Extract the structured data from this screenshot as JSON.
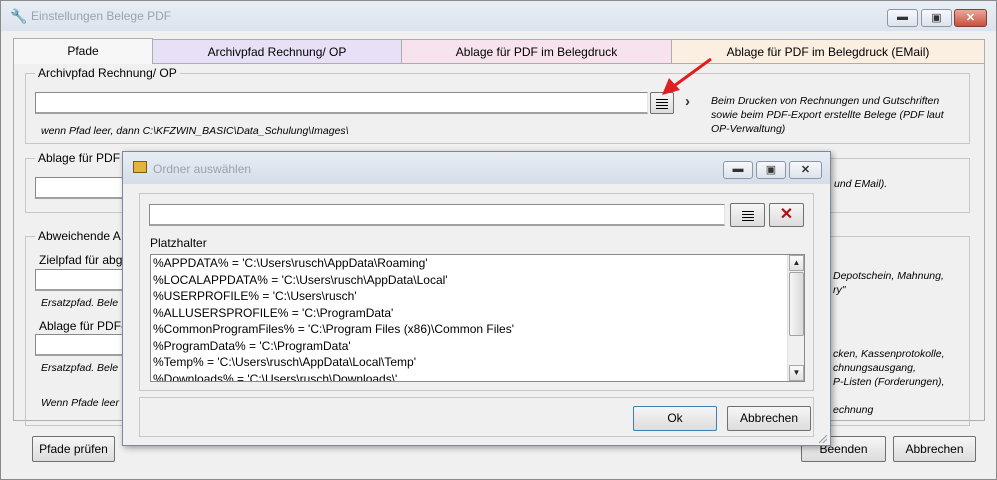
{
  "window": {
    "title": "Einstellungen Belege PDF",
    "controls": {
      "minimize": "▬",
      "maximize": "▣",
      "close": "✕"
    }
  },
  "tabs": [
    {
      "label": "Pfade",
      "color": "#f0f0f0"
    },
    {
      "label": "Archivpfad Rechnung/ OP",
      "color": "#e8e0f7"
    },
    {
      "label": "Ablage für PDF im Belegdruck",
      "color": "#f6e3ee"
    },
    {
      "label": "Ablage für PDF im Belegdruck (EMail)",
      "color": "#fbefe2"
    }
  ],
  "archive_group": {
    "legend": "Archivpfad Rechnung/ OP",
    "path_value": "",
    "hint": "wenn Pfad leer, dann C:\\KFZWIN_BASIC\\Data_Schulung\\Images\\",
    "info": "Beim Drucken von Rechnungen und Gutschriften sowie beim PDF-Export erstellte Belege (PDF laut OP-Verwaltung)"
  },
  "pdf_group": {
    "legend": "Ablage für PDF",
    "info_tail": "und EMail)."
  },
  "deviating_group": {
    "legend": "Abweichende A",
    "target_label": "Zielpfad für abg",
    "replacement_hint_1": "Ersatzpfad. Bele",
    "pdf_label": "Ablage für PDF-",
    "replacement_hint_2": "Ersatzpfad. Bele",
    "footer_hint": "Wenn Pfade leer",
    "info_lines": [
      "Depotschein, Mahnung,",
      "ry\"",
      "",
      "",
      "",
      "",
      "cken, Kassenprotokolle,",
      "chnungsausgang,",
      "P-Listen (Forderungen),",
      "",
      "echnung"
    ]
  },
  "footer": {
    "check_paths": "Pfade prüfen",
    "end": "Beenden",
    "cancel": "Abbrechen"
  },
  "dialog": {
    "title": "Ordner auswählen",
    "path_value": "",
    "placeholder_label": "Platzhalter",
    "items": [
      "%APPDATA% = 'C:\\Users\\rusch\\AppData\\Roaming'",
      "%LOCALAPPDATA% = 'C:\\Users\\rusch\\AppData\\Local'",
      "%USERPROFILE% = 'C:\\Users\\rusch'",
      "%ALLUSERSPROFILE% = 'C:\\ProgramData'",
      "%CommonProgramFiles% = 'C:\\Program Files (x86)\\Common Files'",
      "%ProgramData% = 'C:\\ProgramData'",
      "%Temp% = 'C:\\Users\\rusch\\AppData\\Local\\Temp'",
      "%Downloads% = 'C:\\Users\\rusch\\Downloads\\'"
    ],
    "ok": "Ok",
    "cancel": "Abbrechen"
  },
  "colors": {
    "arrow": "#e02020",
    "close_x": "#b01010"
  }
}
